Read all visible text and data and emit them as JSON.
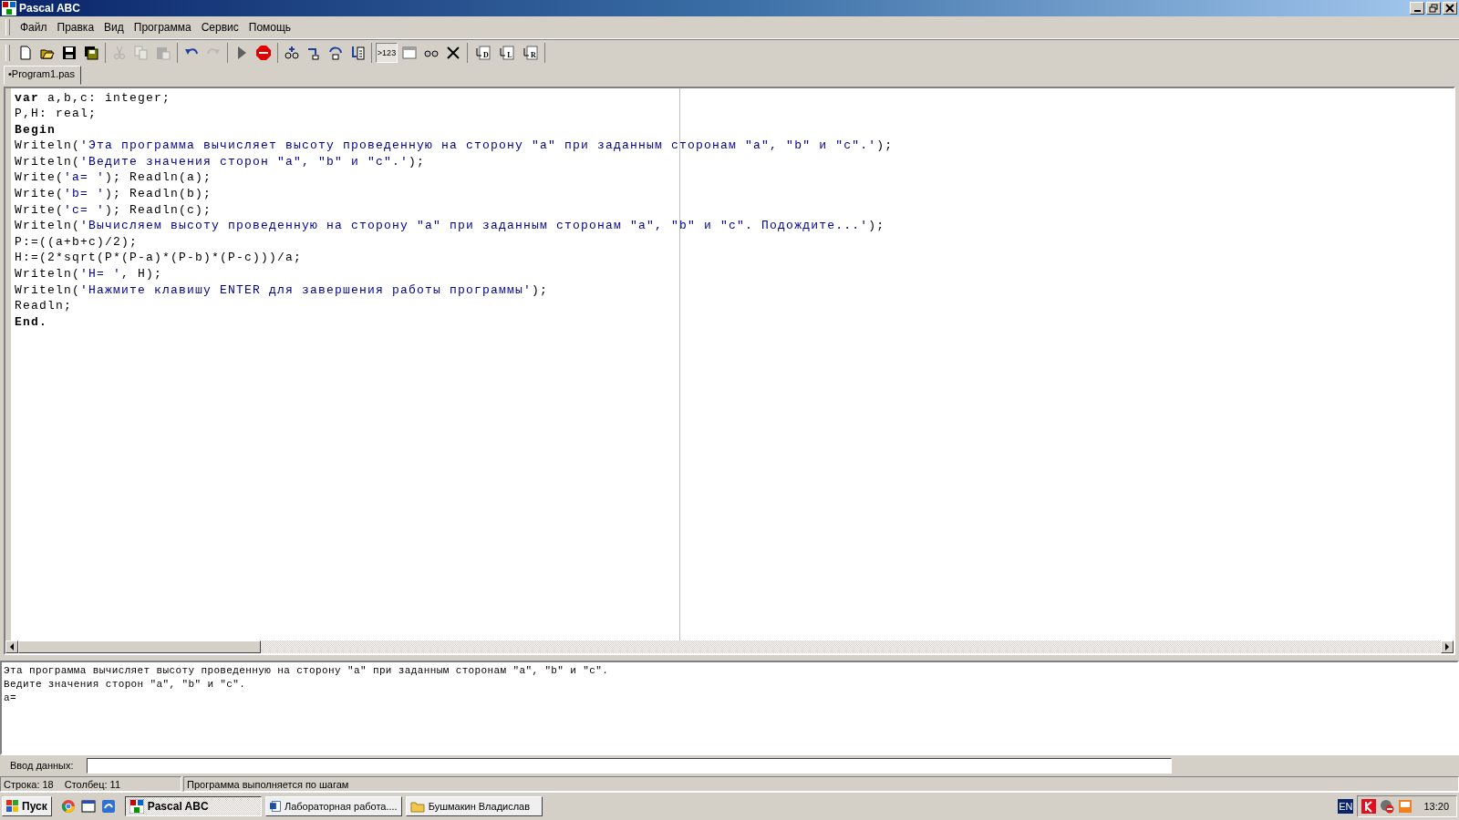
{
  "window": {
    "title": "Pascal ABC"
  },
  "menu": [
    {
      "label": "Файл"
    },
    {
      "label": "Правка"
    },
    {
      "label": "Вид"
    },
    {
      "label": "Программа"
    },
    {
      "label": "Сервис"
    },
    {
      "label": "Помощь"
    }
  ],
  "toolbar": [
    [
      {
        "kind": "new",
        "disabled": false
      },
      {
        "kind": "open",
        "disabled": false
      },
      {
        "kind": "save",
        "disabled": false
      },
      {
        "kind": "saveall",
        "disabled": false
      }
    ],
    [
      {
        "kind": "cut",
        "disabled": true
      },
      {
        "kind": "copy",
        "disabled": true
      },
      {
        "kind": "paste",
        "disabled": true
      }
    ],
    [
      {
        "kind": "undo",
        "disabled": false
      },
      {
        "kind": "redo",
        "disabled": true
      }
    ],
    [
      {
        "kind": "run",
        "disabled": false
      },
      {
        "kind": "stop",
        "disabled": false
      }
    ],
    [
      {
        "kind": "watch",
        "disabled": false
      },
      {
        "kind": "stepinto",
        "disabled": false
      },
      {
        "kind": "stepover",
        "disabled": false
      },
      {
        "kind": "tocursor",
        "disabled": false
      }
    ],
    [
      {
        "kind": "text",
        "label": ">123",
        "pressed": true
      },
      {
        "kind": "window",
        "disabled": false
      },
      {
        "kind": "glasses",
        "disabled": false
      },
      {
        "kind": "close",
        "disabled": false
      }
    ],
    [
      {
        "kind": "doc",
        "letter": "D",
        "disabled": false
      },
      {
        "kind": "doc",
        "letter": "L",
        "disabled": false
      },
      {
        "kind": "doc",
        "letter": "R",
        "disabled": false
      }
    ]
  ],
  "tabs": [
    {
      "label": "•Program1.pas",
      "selected": true
    }
  ],
  "editor": {
    "lines": [
      [
        {
          "kind": "keyword",
          "text": "var"
        },
        {
          "kind": "plain",
          "text": " a,b,c: integer;"
        }
      ],
      [
        {
          "kind": "plain",
          "text": "P,H: real;"
        }
      ],
      [
        {
          "kind": "keyword",
          "text": "Begin"
        }
      ],
      [
        {
          "kind": "plain",
          "text": "Writeln("
        },
        {
          "kind": "string",
          "text": "'Эта программа вычисляет высоту проведенную на сторону \"a\" при заданным сторонам \"a\", \"b\" и \"c\".'"
        },
        {
          "kind": "plain",
          "text": ");"
        }
      ],
      [
        {
          "kind": "plain",
          "text": "Writeln("
        },
        {
          "kind": "string",
          "text": "'Ведите значения сторон \"a\", \"b\" и \"c\".'"
        },
        {
          "kind": "plain",
          "text": ");"
        }
      ],
      [
        {
          "kind": "plain",
          "text": "Write("
        },
        {
          "kind": "string",
          "text": "'a= '"
        },
        {
          "kind": "plain",
          "text": "); Readln(a);"
        }
      ],
      [
        {
          "kind": "plain",
          "text": "Write("
        },
        {
          "kind": "string",
          "text": "'b= '"
        },
        {
          "kind": "plain",
          "text": "); Readln(b);"
        }
      ],
      [
        {
          "kind": "plain",
          "text": "Write("
        },
        {
          "kind": "string",
          "text": "'c= '"
        },
        {
          "kind": "plain",
          "text": "); Readln(c);"
        }
      ],
      [
        {
          "kind": "plain",
          "text": "Writeln("
        },
        {
          "kind": "string",
          "text": "'Вычисляем высоту проведенную на сторону \"a\" при заданным сторонам \"a\", \"b\" и \"c\". Подождите...'"
        },
        {
          "kind": "plain",
          "text": ");"
        }
      ],
      [
        {
          "kind": "plain",
          "text": "P:=((a+b+c)/2);"
        }
      ],
      [
        {
          "kind": "plain",
          "text": "H:=(2*sqrt(P*(P-a)*(P-b)*(P-c)))/a;"
        }
      ],
      [
        {
          "kind": "plain",
          "text": "Writeln("
        },
        {
          "kind": "string",
          "text": "'H= '"
        },
        {
          "kind": "plain",
          "text": ", H);"
        }
      ],
      [
        {
          "kind": "plain",
          "text": "Writeln("
        },
        {
          "kind": "string",
          "text": "'Нажмите клавишу ENTER для завершения работы программы'"
        },
        {
          "kind": "plain",
          "text": ");"
        }
      ],
      [
        {
          "kind": "plain",
          "text": "Readln;"
        }
      ],
      [
        {
          "kind": "keyword",
          "text": "End."
        }
      ]
    ]
  },
  "output": {
    "lines": [
      "Эта программа вычисляет высоту проведенную на сторону \"a\" при заданным сторонам \"a\", \"b\" и \"c\".",
      "Ведите значения сторон \"a\", \"b\" и \"c\".",
      "a="
    ]
  },
  "input": {
    "label": "Ввод данных:"
  },
  "status_bar": {
    "line": "Строка: 18",
    "column": "Столбец: 11",
    "message": "Программа выполняется по шагам"
  },
  "taskbar": {
    "start": "Пуск",
    "tasks": [
      {
        "label": "Pascal ABC",
        "selected": true
      },
      {
        "label": "Лабораторная работа....",
        "selected": false
      },
      {
        "label": "Бушмакин Владислав",
        "selected": false
      }
    ],
    "language": "EN",
    "clock": "13:20"
  }
}
